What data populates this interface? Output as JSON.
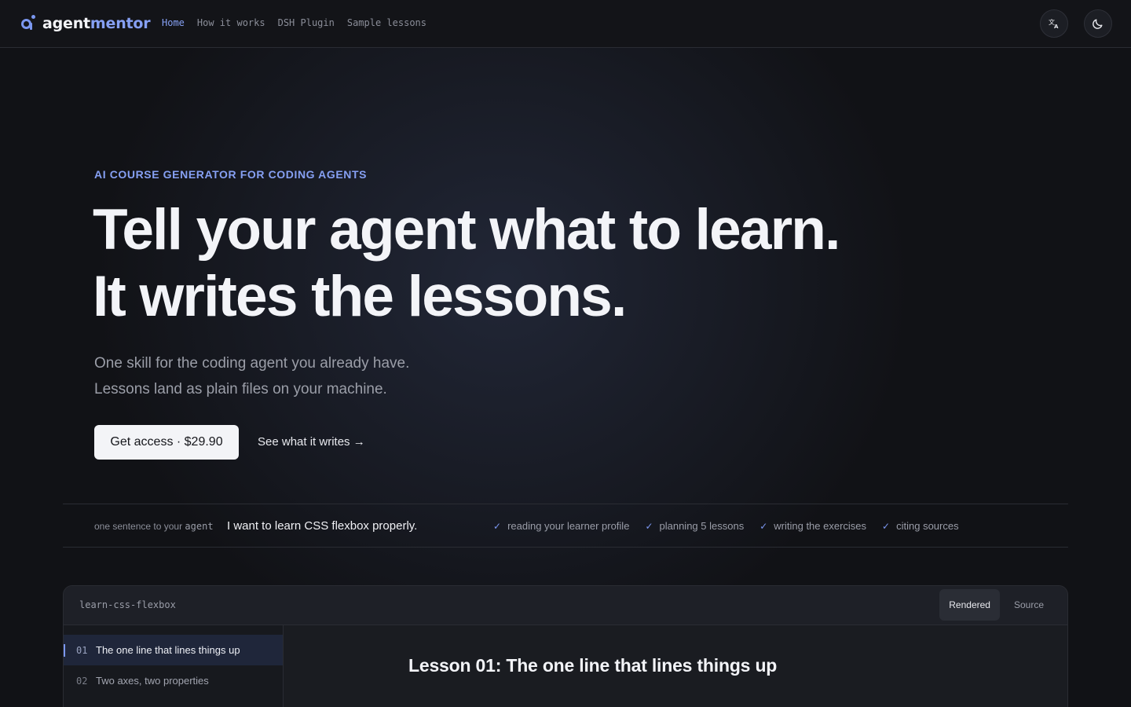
{
  "nav": {
    "logo_part1": "agent",
    "logo_part2": "mentor",
    "links": [
      "Home",
      "How it works",
      "DSH Plugin",
      "Sample lessons"
    ],
    "active_link": "Home"
  },
  "hero": {
    "eyebrow": "AI COURSE GENERATOR FOR CODING AGENTS",
    "headline_line1": "Tell your agent what to learn.",
    "headline_line2": "It writes the lessons.",
    "sub_line1": "One skill for the coding agent you already have.",
    "sub_line2": "Lessons land as plain files on your machine.",
    "cta_primary": "Get access · $29.90",
    "cta_secondary": "See what it writes →"
  },
  "strip": {
    "label_prefix": "one sentence to your",
    "label_mono": "agent",
    "prompt": "I want to learn CSS flexbox properly.",
    "steps": [
      "reading your learner profile",
      "planning 5 lessons",
      "writing the exercises",
      "citing sources"
    ]
  },
  "panel": {
    "title": "learn-css-flexbox",
    "tabs": [
      "Rendered",
      "Source"
    ],
    "active_tab": "Rendered",
    "lessons": [
      {
        "num": "01",
        "title": "The one line that lines things up"
      },
      {
        "num": "02",
        "title": "Two axes, two properties"
      }
    ],
    "lesson_heading": "Lesson 01: The one line that lines things up"
  },
  "colors": {
    "accent": "#86a0f3",
    "background": "#111216",
    "text": "#f3f4f8"
  }
}
